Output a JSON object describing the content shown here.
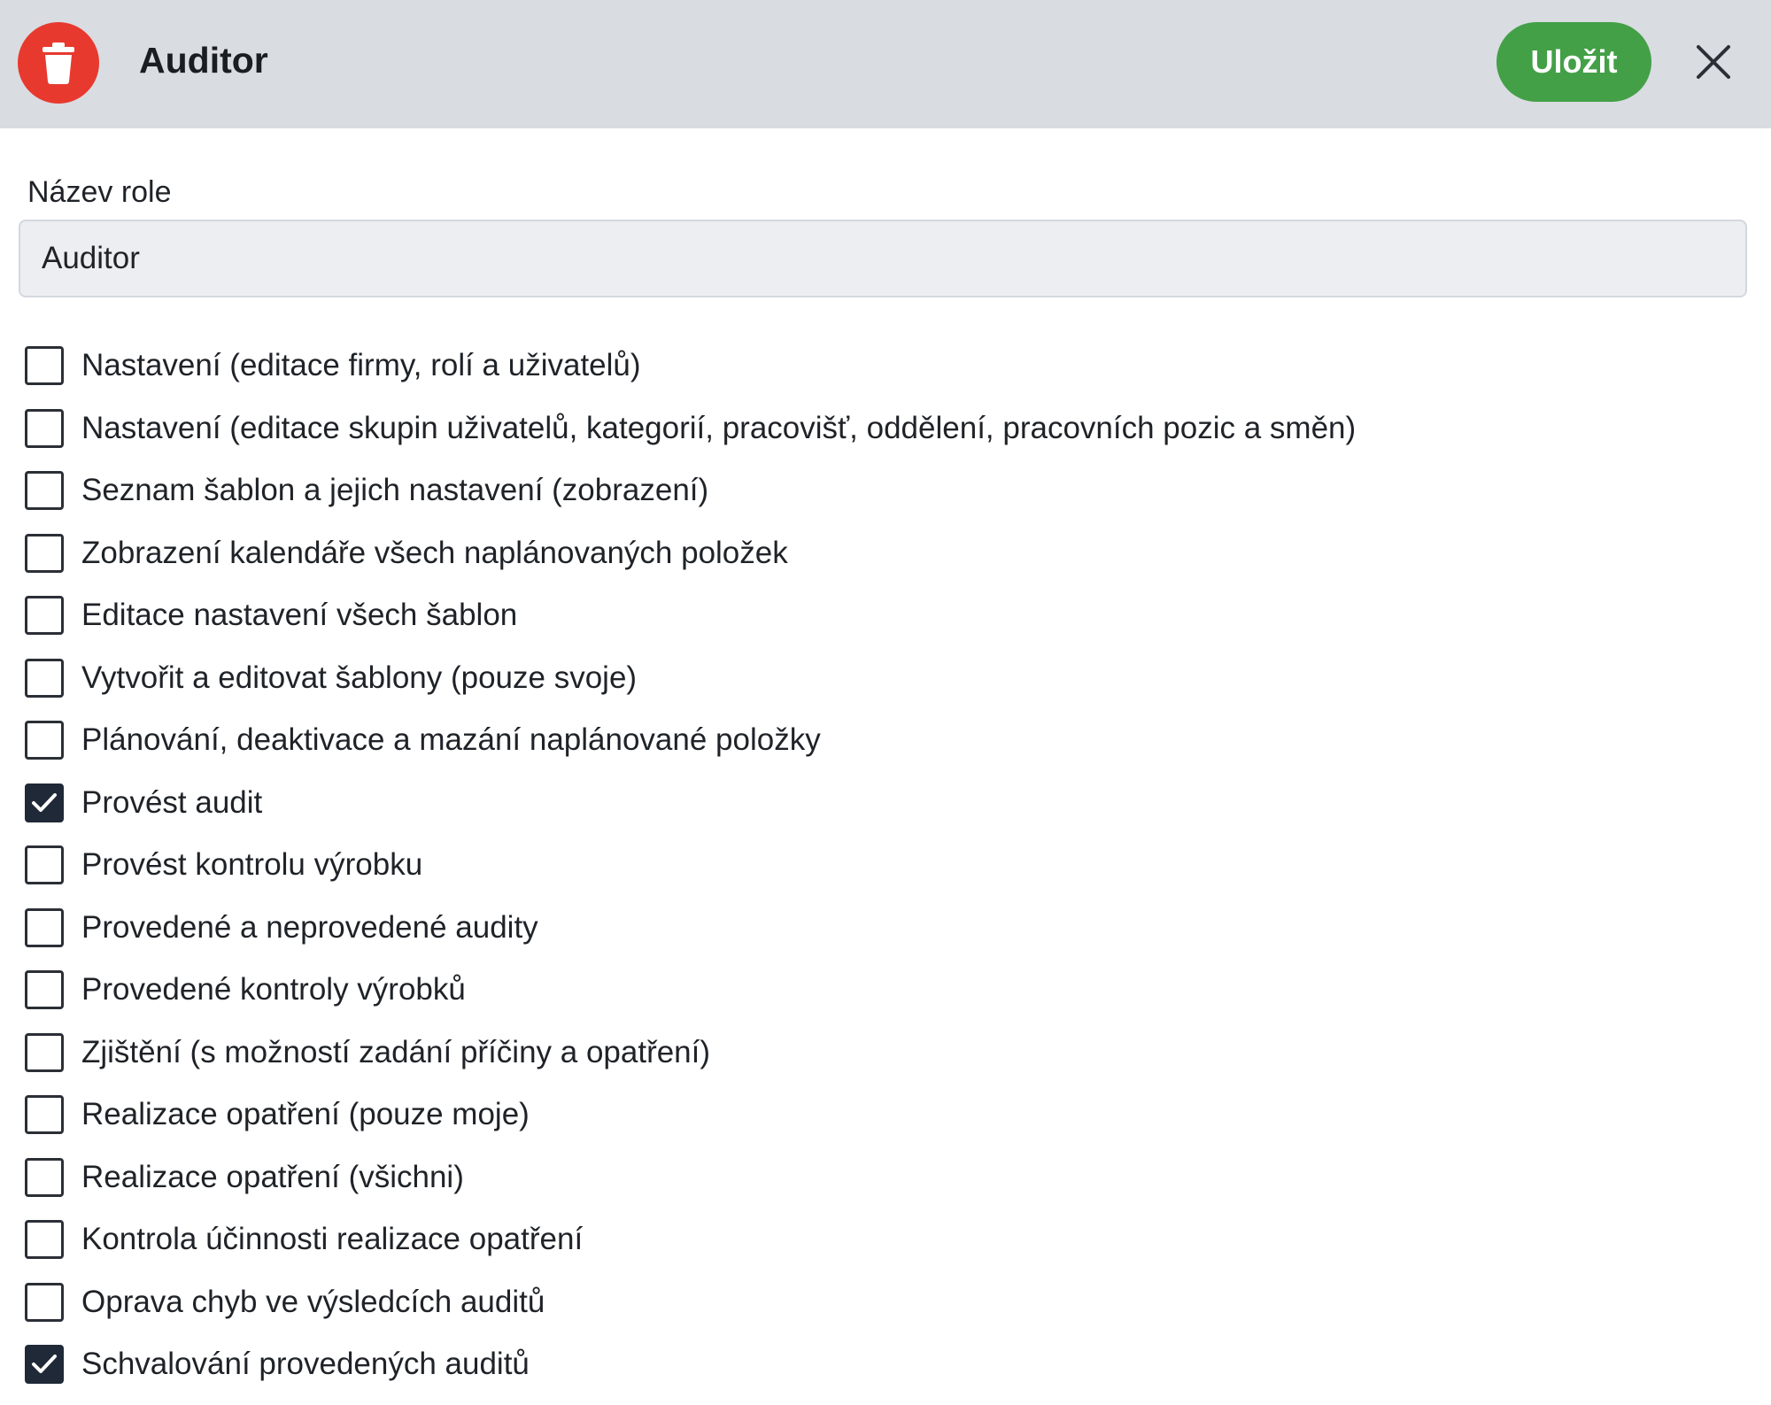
{
  "header": {
    "title": "Auditor",
    "save_label": "Uložit",
    "delete_icon": "trash-icon",
    "close_icon": "close-icon",
    "delete_color": "#e8392f",
    "save_color": "#43a047"
  },
  "form": {
    "role_name_label": "Název role",
    "role_name_value": "Auditor"
  },
  "permissions": [
    {
      "label": "Nastavení (editace firmy, rolí a uživatelů)",
      "checked": false
    },
    {
      "label": "Nastavení (editace skupin uživatelů, kategorií, pracovišť, oddělení, pracovních pozic a směn)",
      "checked": false
    },
    {
      "label": "Seznam šablon a jejich nastavení (zobrazení)",
      "checked": false
    },
    {
      "label": "Zobrazení kalendáře všech naplánovaných položek",
      "checked": false
    },
    {
      "label": "Editace nastavení všech šablon",
      "checked": false
    },
    {
      "label": "Vytvořit a editovat šablony (pouze svoje)",
      "checked": false
    },
    {
      "label": "Plánování, deaktivace a mazání naplánované položky",
      "checked": false
    },
    {
      "label": "Provést audit",
      "checked": true
    },
    {
      "label": "Provést kontrolu výrobku",
      "checked": false
    },
    {
      "label": "Provedené a neprovedené audity",
      "checked": false
    },
    {
      "label": "Provedené kontroly výrobků",
      "checked": false
    },
    {
      "label": "Zjištění (s možností zadání příčiny a opatření)",
      "checked": false
    },
    {
      "label": "Realizace opatření (pouze moje)",
      "checked": false
    },
    {
      "label": "Realizace opatření (všichni)",
      "checked": false
    },
    {
      "label": "Kontrola účinnosti realizace opatření",
      "checked": false
    },
    {
      "label": "Oprava chyb ve výsledcích auditů",
      "checked": false
    },
    {
      "label": "Schvalování provedených auditů",
      "checked": true
    }
  ]
}
